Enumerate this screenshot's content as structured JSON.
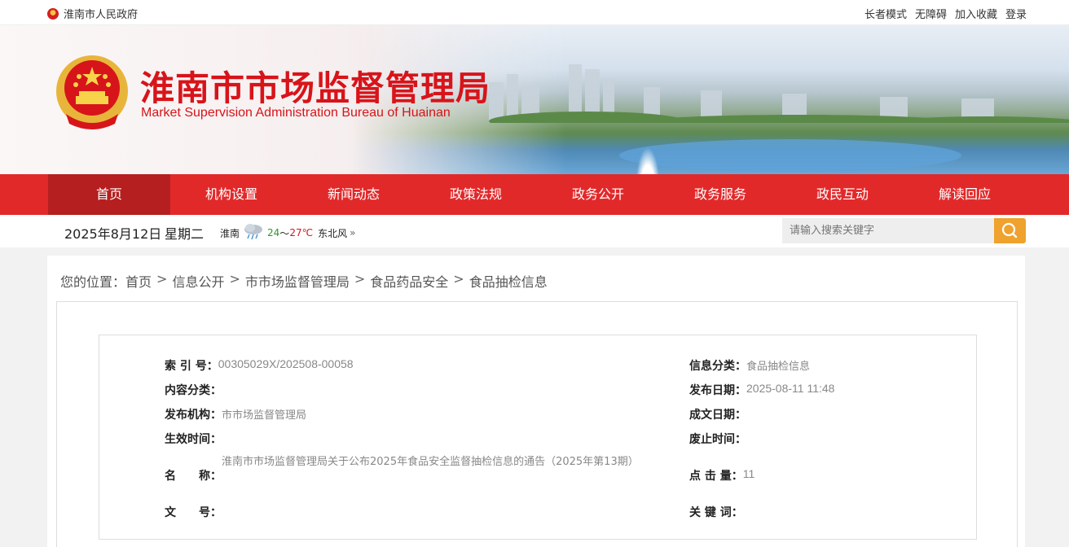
{
  "topbar": {
    "gov_name": "淮南市人民政府",
    "links": [
      "长者模式",
      "无障碍",
      "加入收藏",
      "登录"
    ]
  },
  "header": {
    "title_cn": "淮南市市场监督管理局",
    "title_en": "Market Supervision Administration Bureau of Huainan"
  },
  "nav": {
    "items": [
      "首页",
      "机构设置",
      "新闻动态",
      "政策法规",
      "政务公开",
      "政务服务",
      "政民互动",
      "解读回应"
    ],
    "active_index": 0
  },
  "infobar": {
    "date": "2025年8月12日",
    "weekday": "星期二",
    "weather": {
      "city": "淮南",
      "icon": "rain-cloud-icon",
      "low": "24",
      "sep": "～",
      "high": "27℃",
      "wind": "东北风",
      "more": "»"
    },
    "search_placeholder": "请输入搜索关键字"
  },
  "breadcrumb": {
    "prefix": "您的位置：",
    "items": [
      "首页",
      "信息公开",
      "市市场监督管理局",
      "食品药品安全",
      "食品抽检信息"
    ],
    "sep": ">"
  },
  "meta": {
    "index_label": "索 引 号：",
    "index_value": "00305029X/202508-00058",
    "category_label": "信息分类：",
    "category_value": "食品抽检信息",
    "content_label": "内容分类：",
    "content_value": "",
    "pubdate_label": "发布日期：",
    "pubdate_value": "2025-08-11 11:48",
    "org_label": "发布机构：",
    "org_value": "市市场监督管理局",
    "written_label": "成文日期：",
    "written_value": "",
    "effective_label": "生效时间：",
    "effective_value": "",
    "abolish_label": "废止时间：",
    "abolish_value": "",
    "name_label": "名　　称：",
    "name_value": "淮南市市场监督管理局关于公布2025年食品安全监督抽检信息的通告（2025年第13期）",
    "clicks_label": "点 击 量：",
    "clicks_value": "11",
    "docno_label": "文　　号：",
    "docno_value": "",
    "keywords_label": "关 键 词：",
    "keywords_value": ""
  },
  "colors": {
    "brand_red": "#e2292a",
    "nav_active": "#b51f1f",
    "search_button": "#f0a22e"
  }
}
